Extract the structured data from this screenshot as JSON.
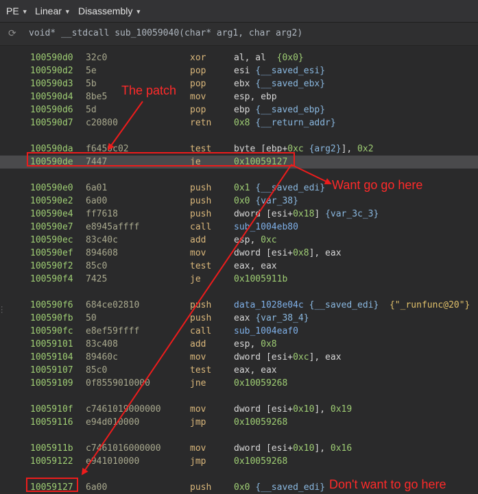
{
  "toolbar": {
    "view_type": "PE",
    "layout": "Linear",
    "mode": "Disassembly"
  },
  "signature": {
    "text": "void* __stdcall sub_10059040(char* arg1, char arg2)"
  },
  "rows": [
    {
      "addr": "100590d0",
      "bytes": "32c0",
      "mn": "xor",
      "ops": [
        [
          "al, al  ",
          "t"
        ],
        [
          "{0x0}",
          "n"
        ]
      ]
    },
    {
      "addr": "100590d2",
      "bytes": "5e",
      "mn": "pop",
      "ops": [
        [
          "esi ",
          "t"
        ],
        [
          "{__saved_esi}",
          "v"
        ]
      ]
    },
    {
      "addr": "100590d3",
      "bytes": "5b",
      "mn": "pop",
      "ops": [
        [
          "ebx ",
          "t"
        ],
        [
          "{__saved_ebx}",
          "v"
        ]
      ]
    },
    {
      "addr": "100590d4",
      "bytes": "8be5",
      "mn": "mov",
      "ops": [
        [
          "esp, ebp",
          "t"
        ]
      ]
    },
    {
      "addr": "100590d6",
      "bytes": "5d",
      "mn": "pop",
      "ops": [
        [
          "ebp ",
          "t"
        ],
        [
          "{__saved_ebp}",
          "v"
        ]
      ]
    },
    {
      "addr": "100590d7",
      "bytes": "c20800",
      "mn": "retn",
      "ops": [
        [
          "0x8",
          "n"
        ],
        [
          " ",
          "t"
        ],
        [
          "{__return_addr}",
          "v"
        ]
      ]
    },
    {
      "addr": "100590da",
      "bytes": "f6450c02",
      "mn": "test",
      "ops": [
        [
          "byte [ebp+",
          "t"
        ],
        [
          "0xc",
          "n"
        ],
        [
          " ",
          "t"
        ],
        [
          "{arg2}",
          "v"
        ],
        [
          "], ",
          "t"
        ],
        [
          "0x2",
          "n"
        ]
      ]
    },
    {
      "addr": "100590de",
      "bytes": "7447",
      "mn": "je",
      "ops": [
        [
          "0x10059127",
          "n"
        ]
      ]
    },
    {
      "addr": "100590e0",
      "bytes": "6a01",
      "mn": "push",
      "ops": [
        [
          "0x1",
          "n"
        ],
        [
          " ",
          "t"
        ],
        [
          "{__saved_edi}",
          "v"
        ]
      ]
    },
    {
      "addr": "100590e2",
      "bytes": "6a00",
      "mn": "push",
      "ops": [
        [
          "0x0",
          "n"
        ],
        [
          " ",
          "t"
        ],
        [
          "{var_38}",
          "v"
        ]
      ]
    },
    {
      "addr": "100590e4",
      "bytes": "ff7618",
      "mn": "push",
      "ops": [
        [
          "dword [esi+",
          "t"
        ],
        [
          "0x18",
          "n"
        ],
        [
          "] ",
          "t"
        ],
        [
          "{var_3c_3}",
          "v"
        ]
      ]
    },
    {
      "addr": "100590e7",
      "bytes": "e8945affff",
      "mn": "call",
      "ops": [
        [
          "sub_1004eb80",
          "f"
        ]
      ]
    },
    {
      "addr": "100590ec",
      "bytes": "83c40c",
      "mn": "add",
      "ops": [
        [
          "esp, ",
          "t"
        ],
        [
          "0xc",
          "n"
        ]
      ]
    },
    {
      "addr": "100590ef",
      "bytes": "894608",
      "mn": "mov",
      "ops": [
        [
          "dword [esi+",
          "t"
        ],
        [
          "0x8",
          "n"
        ],
        [
          "], eax",
          "t"
        ]
      ]
    },
    {
      "addr": "100590f2",
      "bytes": "85c0",
      "mn": "test",
      "ops": [
        [
          "eax, eax",
          "t"
        ]
      ]
    },
    {
      "addr": "100590f4",
      "bytes": "7425",
      "mn": "je",
      "ops": [
        [
          "0x1005911b",
          "n"
        ]
      ]
    },
    {
      "addr": "100590f6",
      "bytes": "684ce02810",
      "mn": "push",
      "ops": [
        [
          "data_1028e04c",
          "f"
        ],
        [
          " ",
          "t"
        ],
        [
          "{__saved_edi}",
          "v"
        ],
        [
          "  ",
          "t"
        ],
        [
          "{\"_runfunc@20\"}",
          "s"
        ]
      ]
    },
    {
      "addr": "100590fb",
      "bytes": "50",
      "mn": "push",
      "ops": [
        [
          "eax ",
          "t"
        ],
        [
          "{var_38_4}",
          "v"
        ]
      ]
    },
    {
      "addr": "100590fc",
      "bytes": "e8ef59ffff",
      "mn": "call",
      "ops": [
        [
          "sub_1004eaf0",
          "f"
        ]
      ]
    },
    {
      "addr": "10059101",
      "bytes": "83c408",
      "mn": "add",
      "ops": [
        [
          "esp, ",
          "t"
        ],
        [
          "0x8",
          "n"
        ]
      ]
    },
    {
      "addr": "10059104",
      "bytes": "89460c",
      "mn": "mov",
      "ops": [
        [
          "dword [esi+",
          "t"
        ],
        [
          "0xc",
          "n"
        ],
        [
          "], eax",
          "t"
        ]
      ]
    },
    {
      "addr": "10059107",
      "bytes": "85c0",
      "mn": "test",
      "ops": [
        [
          "eax, eax",
          "t"
        ]
      ]
    },
    {
      "addr": "10059109",
      "bytes": "0f8559010000",
      "mn": "jne",
      "ops": [
        [
          "0x10059268",
          "n"
        ]
      ]
    },
    {
      "addr": "1005910f",
      "bytes": "c7461019000000",
      "mn": "mov",
      "ops": [
        [
          "dword [esi+",
          "t"
        ],
        [
          "0x10",
          "n"
        ],
        [
          "], ",
          "t"
        ],
        [
          "0x19",
          "n"
        ]
      ]
    },
    {
      "addr": "10059116",
      "bytes": "e94d010000",
      "mn": "jmp",
      "ops": [
        [
          "0x10059268",
          "n"
        ]
      ]
    },
    {
      "addr": "1005911b",
      "bytes": "c7461016000000",
      "mn": "mov",
      "ops": [
        [
          "dword [esi+",
          "t"
        ],
        [
          "0x10",
          "n"
        ],
        [
          "], ",
          "t"
        ],
        [
          "0x16",
          "n"
        ]
      ]
    },
    {
      "addr": "10059122",
      "bytes": "e941010000",
      "mn": "jmp",
      "ops": [
        [
          "0x10059268",
          "n"
        ]
      ]
    },
    {
      "addr": "10059127",
      "bytes": "6a00",
      "mn": "push",
      "ops": [
        [
          "0x0",
          "n"
        ],
        [
          " ",
          "t"
        ],
        [
          "{__saved_edi}",
          "v"
        ]
      ]
    }
  ],
  "annotations": {
    "patch": "The patch",
    "want": "Want go go here",
    "dont_want": "Don't want to go here"
  },
  "colors": {
    "annotation": "#ff2a2a",
    "address": "#9fce74",
    "mnemonic": "#dbb87b"
  }
}
